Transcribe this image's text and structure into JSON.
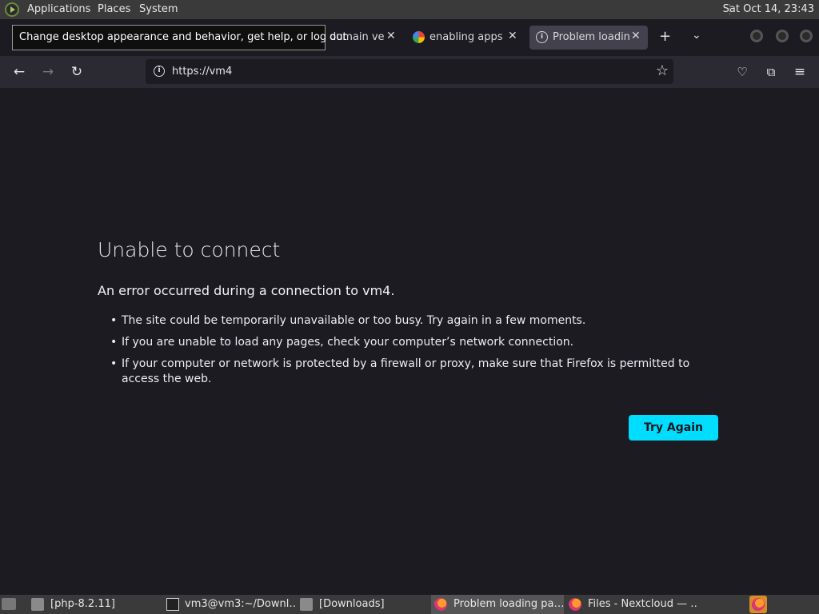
{
  "topbar": {
    "menus": [
      "Applications",
      "Places",
      "System"
    ],
    "clock": "Sat Oct 14, 23:43"
  },
  "tooltip": "Change desktop appearance and behavior, get help, or log out",
  "tabs": [
    {
      "label": "domain ver",
      "icon": "generic-page-icon"
    },
    {
      "label": "enabling apps si",
      "icon": "google-icon"
    },
    {
      "label": "Problem loading",
      "icon": "info-icon",
      "active": true
    }
  ],
  "navbar": {
    "url": "https://vm4"
  },
  "error": {
    "title": "Unable to connect",
    "description": "An error occurred during a connection to vm4.",
    "items": [
      "The site could be temporarily unavailable or too busy. Try again in a few moments.",
      "If you are unable to load any pages, check your computer’s network connection.",
      "If your computer or network is protected by a firewall or proxy, make sure that Firefox is permitted to access the web."
    ],
    "button": "Try Again"
  },
  "taskbar": {
    "tasks": [
      {
        "label": "[php-8.2.11]",
        "icon": "folder-icon"
      },
      {
        "label": "vm3@vm3:~/Downl…",
        "icon": "terminal-icon"
      },
      {
        "label": "[Downloads]",
        "icon": "folder-icon"
      },
      {
        "label": "Problem loading pa…",
        "icon": "firefox-icon",
        "active": true
      },
      {
        "label": "Files - Nextcloud — …",
        "icon": "firefox-icon"
      }
    ]
  },
  "colors": {
    "accent": "#00ddff",
    "page_bg": "#1c1b22",
    "toolbar_bg": "#2b2a33",
    "panel_bg": "#3a3a3a"
  }
}
